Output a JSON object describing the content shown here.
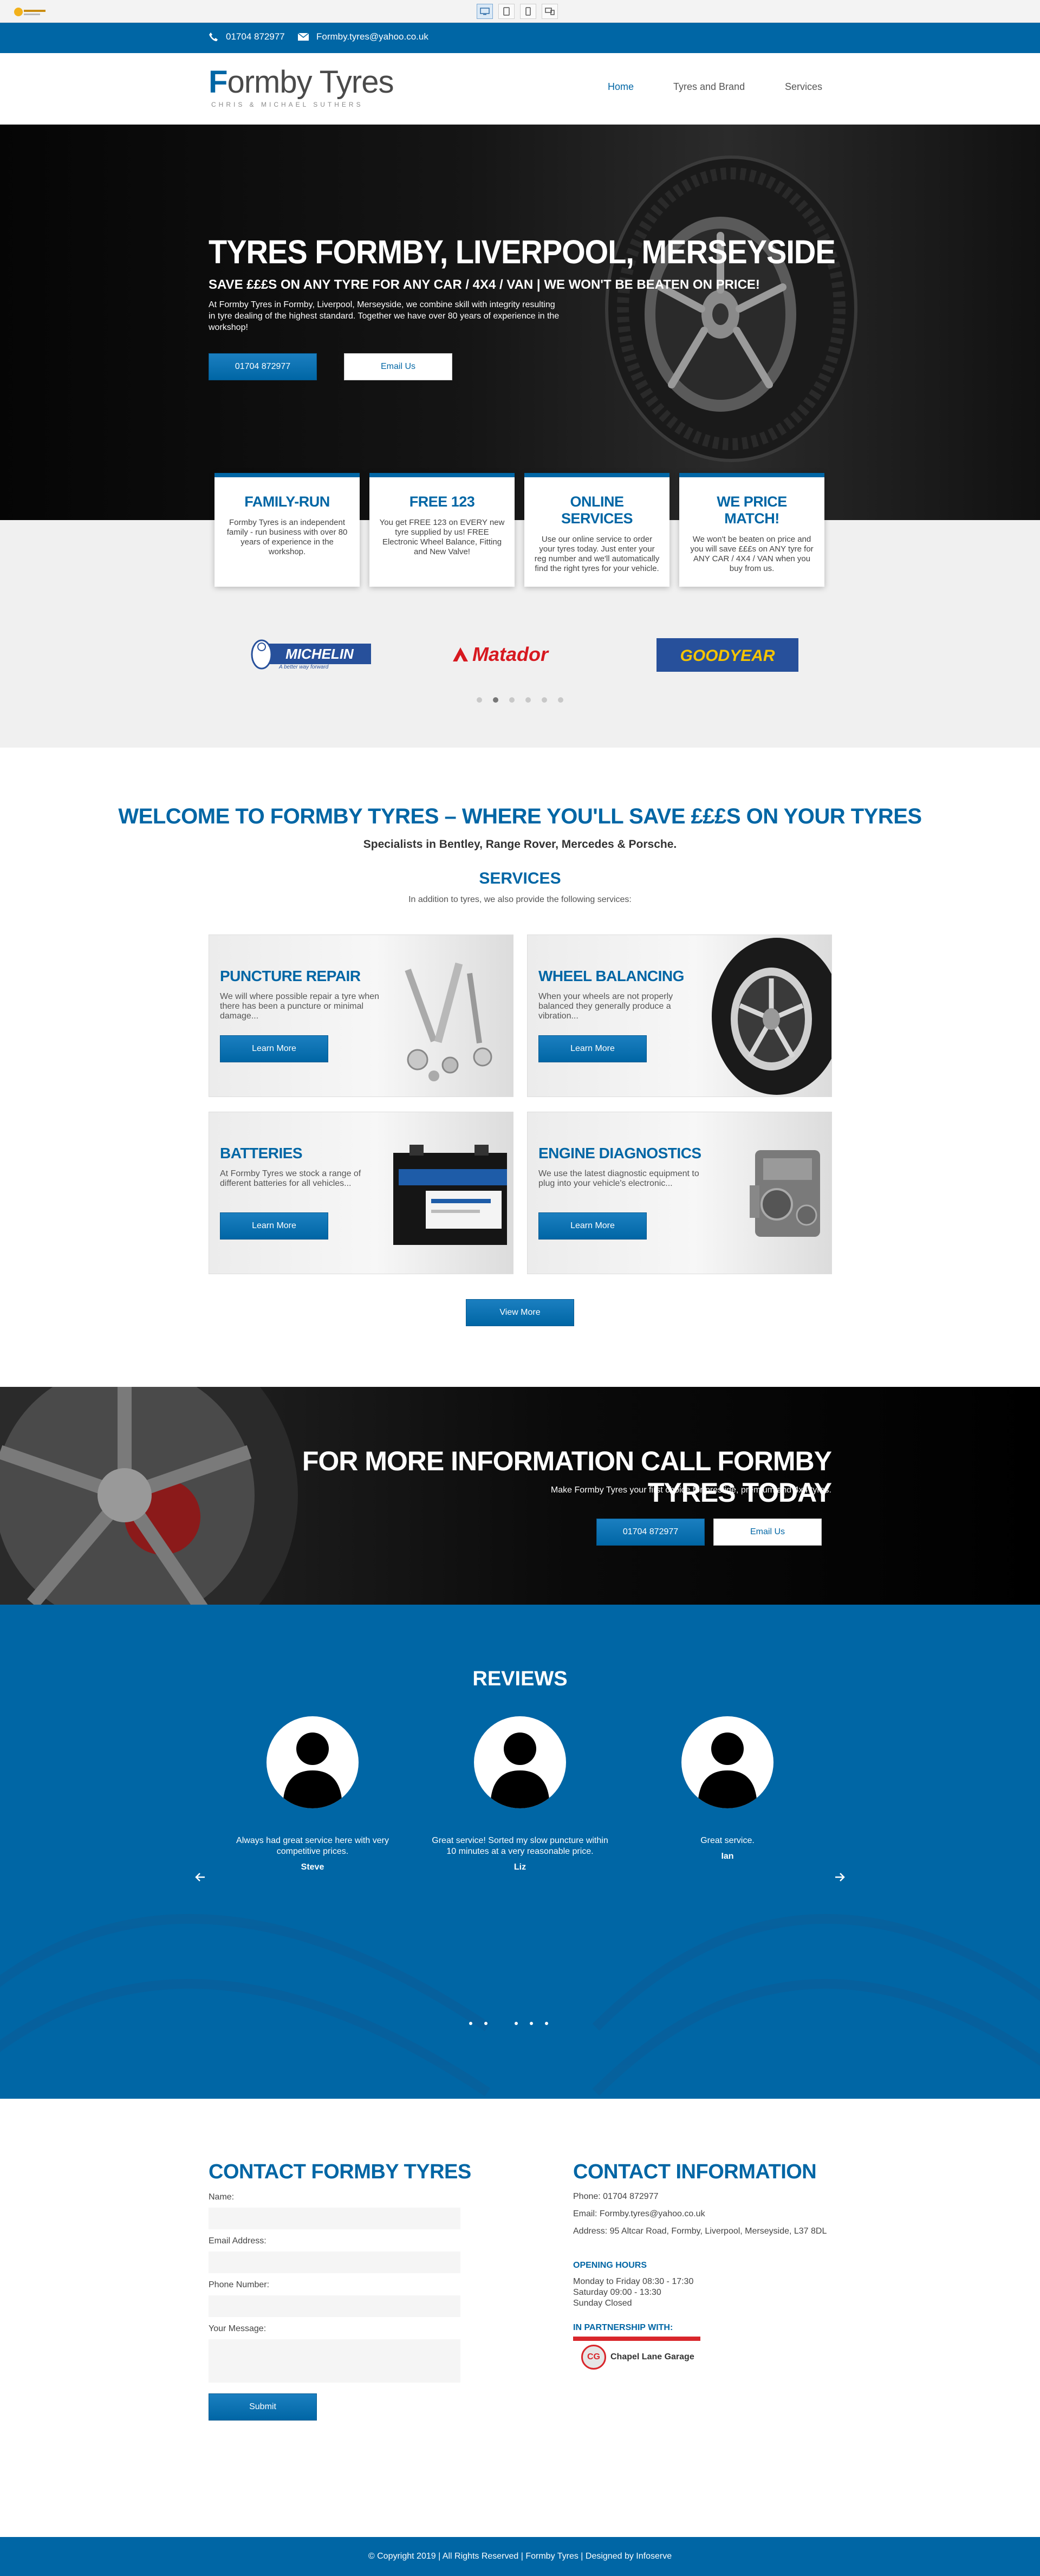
{
  "topbar": {
    "phone": "01704 872977",
    "email": "Formby.tyres@yahoo.co.uk"
  },
  "header": {
    "logo_prefix": "F",
    "logo_rest": "ormby Tyres",
    "logo_tagline": "CHRIS & MICHAEL SUTHERS",
    "nav": [
      "Home",
      "Tyres and Brand",
      "Services"
    ]
  },
  "hero": {
    "title": "TYRES FORMBY, LIVERPOOL, MERSEYSIDE",
    "subtitle": "SAVE £££S ON ANY TYRE FOR ANY CAR / 4X4 / VAN | WE WON'T BE BEATEN ON PRICE!",
    "text": "At Formby Tyres in Formby, Liverpool, Merseyside, we combine skill with integrity resulting in tyre dealing of the highest standard. Together we have over 80 years of experience in the workshop!",
    "phone_button": "01704 872977",
    "email_button": "Email Us"
  },
  "features": [
    {
      "title": "FAMILY-RUN",
      "text": "Formby Tyres is an independent family - run business with over 80 years of experience in the workshop."
    },
    {
      "title": "FREE 123",
      "text": "You get FREE 123 on EVERY new tyre supplied by us! FREE Electronic Wheel Balance, Fitting and New Valve!"
    },
    {
      "title": "ONLINE SERVICES",
      "text": "Use our online service to order your tyres today. Just enter your reg number and we'll automatically find the right tyres for your vehicle."
    },
    {
      "title": "WE PRICE MATCH!",
      "text": "We won't be beaten on price and you will save £££s on ANY tyre for ANY CAR / 4X4 / VAN when you buy from us."
    }
  ],
  "brands": {
    "michelin": "MICHELIN",
    "michelin_tag": "A better way forward",
    "matador": "Matador",
    "goodyear": "GOODYEAR"
  },
  "welcome": {
    "title": "WELCOME TO FORMBY TYRES – WHERE YOU'LL SAVE £££S ON YOUR TYRES",
    "subtitle": "Specialists in Bentley, Range Rover, Mercedes & Porsche.",
    "services_title": "SERVICES",
    "services_sub": "In addition to tyres, we also provide the following services:"
  },
  "services": [
    {
      "title": "PUNCTURE REPAIR",
      "text": "We will where possible repair a tyre when there has been a puncture or minimal damage...",
      "button": "Learn More"
    },
    {
      "title": "WHEEL BALANCING",
      "text": "When your wheels are not properly balanced they generally produce a vibration...",
      "button": "Learn More"
    },
    {
      "title": "BATTERIES",
      "text": "At Formby Tyres we stock a range of different batteries for all vehicles...",
      "button": "Learn More"
    },
    {
      "title": "ENGINE DIAGNOSTICS",
      "text": "We use the latest diagnostic equipment to plug into your vehicle's electronic...",
      "button": "Learn More"
    }
  ],
  "view_more": "View More",
  "cta": {
    "title": "FOR MORE INFORMATION CALL FORMBY TYRES TODAY",
    "subtitle": "Make Formby Tyres your first choice for prestige, premium and 4x4 tyres.",
    "phone_button": "01704 872977",
    "email_button": "Email Us"
  },
  "reviews": {
    "title": "REVIEWS",
    "items": [
      {
        "text": "Always had great service here with very competitive prices.",
        "name": "Steve"
      },
      {
        "text": "Great service! Sorted my slow puncture within 10 minutes at a very reasonable price.",
        "name": "Liz"
      },
      {
        "text": "Great service.",
        "name": "Ian"
      }
    ]
  },
  "contact_form": {
    "title": "CONTACT FORMBY TYRES",
    "name_label": "Name:",
    "email_label": "Email Address:",
    "phone_label": "Phone Number:",
    "message_label": "Your Message:",
    "submit": "Submit"
  },
  "contact_info": {
    "title": "CONTACT INFORMATION",
    "phone": "Phone: 01704 872977",
    "email": "Email: Formby.tyres@yahoo.co.uk",
    "address": "Address: 95 Altcar Road, Formby, Liverpool, Merseyside, L37 8DL",
    "hours_title": "OPENING HOURS",
    "hours": [
      "Monday to Friday 08:30 - 17:30",
      "Saturday 09:00 - 13:30",
      "Sunday Closed"
    ],
    "partner_title": "IN PARTNERSHIP WITH:",
    "partner_name": "Chapel Lane Garage",
    "partner_initials": "CG"
  },
  "footer": "© Copyright 2019 | All Rights Reserved | Formby Tyres | Designed by Infoserve",
  "colors": {
    "brand": "#0066a5",
    "dark": "#0a0a0a",
    "light_bg": "#f0f0f0",
    "partner_red": "#d9262b"
  }
}
